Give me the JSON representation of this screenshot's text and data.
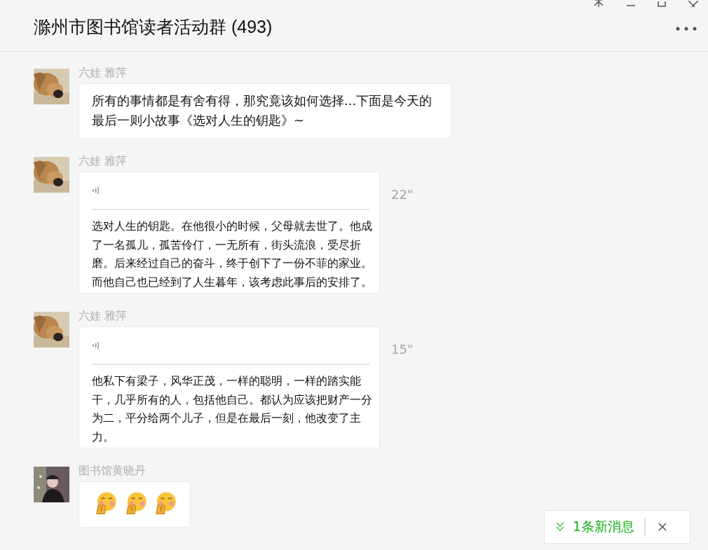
{
  "window": {
    "title": "滁州市图书馆读者活动群 (493)"
  },
  "messages": [
    {
      "kind": "text",
      "sender": "六娃 雅萍",
      "avatar": {
        "kind": "picture"
      },
      "text": "所有的事情都是有舍有得，那究竟该如何选择...下面是今天的最后一则小故事《选对人生的钥匙》~"
    },
    {
      "kind": "voice",
      "sender": "六娃 雅萍",
      "avatar": {
        "kind": "picture"
      },
      "duration": "22\"",
      "transcript": "选对人生的钥匙。在他很小的时候，父母就去世了。他成了一名孤儿，孤苦伶仃，一无所有，街头流浪，受尽折磨。后来经过自己的奋斗，终于创下了一份不菲的家业。而他自己也已经到了人生暮年，该考虑此事后的安排了。"
    },
    {
      "kind": "voice",
      "sender": "六娃 雅萍",
      "avatar": {
        "kind": "picture"
      },
      "duration": "15\"",
      "transcript": "他私下有梁子，风华正茂，一样的聪明，一样的踏实能干，几乎所有的人，包括他自己。都认为应该把财产一分为二，平分给两个儿子，但是在最后一刻，他改变了主力。"
    },
    {
      "kind": "emoji",
      "sender": "图书馆黄晓丹",
      "avatar": {
        "kind": "picture"
      },
      "emojis": [
        {
          "kind": "blush"
        },
        {
          "kind": "blush"
        },
        {
          "kind": "blush"
        }
      ]
    }
  ],
  "new_messages": {
    "label": "1条新消息"
  }
}
